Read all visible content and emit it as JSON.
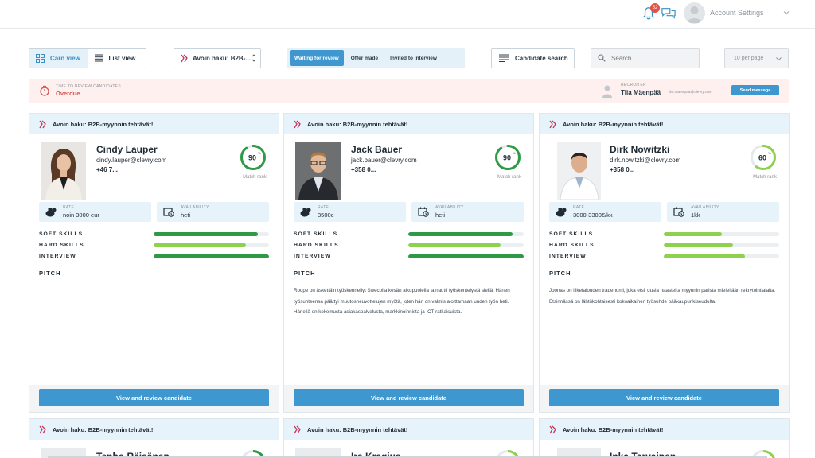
{
  "header": {
    "notification_count": "52",
    "account_label": "Account Settings"
  },
  "toolbar": {
    "card_view": "Card view",
    "list_view": "List view",
    "job_select": "Avoin haku: B2B-...",
    "status_tabs": [
      "Waiting for review",
      "Offer made",
      "Invited to interview"
    ],
    "candidate_search": "Candidate search",
    "search_placeholder": "Search",
    "per_page": "10 per page"
  },
  "banner": {
    "label": "TIME TO REVIEW CANDIDATES",
    "value": "Overdue",
    "recruiter_label": "RECRUITER",
    "recruiter_name": "Tiia Mäenpää",
    "recruiter_email": "tiia.maenpaa@clevry.com",
    "send_message": "Send message"
  },
  "colors": {
    "accent": "#3f97d0",
    "overdue": "#d9534f",
    "bar_dark": "#2e9a45",
    "bar_light": "#8dd14f"
  },
  "cards": [
    {
      "job": "Avoin haku: B2B-myynnin tehtävät!",
      "name": "Cindy Lauper",
      "email": "cindy.lauper@clevry.com",
      "phone": "+46 7...",
      "rank": "90",
      "rank_label": "Match rank",
      "rate_label": "RATE",
      "rate": "noin 3000 eur",
      "availability_label": "AVAILABILITY",
      "availability": "heti",
      "skills": [
        {
          "label": "SOFT SKILLS",
          "value": 0.9
        },
        {
          "label": "HARD SKILLS",
          "value": 0.8
        },
        {
          "label": "INTERVIEW",
          "value": 1.0
        }
      ],
      "pitch_label": "PITCH",
      "pitch": "",
      "button": "View and review candidate"
    },
    {
      "job": "Avoin haku: B2B-myynnin tehtävät!",
      "name": "Jack Bauer",
      "email": "jack.bauer@clevry.com",
      "phone": "+358 0...",
      "rank": "90",
      "rank_label": "Match rank",
      "rate_label": "RATE",
      "rate": "3500e",
      "availability_label": "AVAILABILITY",
      "availability": "heti",
      "skills": [
        {
          "label": "SOFT SKILLS",
          "value": 0.9
        },
        {
          "label": "HARD SKILLS",
          "value": 0.8
        },
        {
          "label": "INTERVIEW",
          "value": 1.0
        }
      ],
      "pitch_label": "PITCH",
      "pitch": "Roope on äskettäin työskennellyt Swecolla kesän alkupuolella ja nautti työskentelystä siellä. Hänen työsuhteensa päättyi muutosneuvottelujen myötä, joten hän on valmis aloittamaan uuden työn heti. Hänellä on kokemusta asiakaspalvelusta, markkinoinnista ja ICT-ratkaisuista.",
      "button": "View and review candidate"
    },
    {
      "job": "Avoin haku: B2B-myynnin tehtävät!",
      "name": "Dirk Nowitzki",
      "email": "dirk.nowitzki@clevry.com",
      "phone": "+358 0...",
      "rank": "60",
      "rank_label": "Match rank",
      "rate_label": "RATE",
      "rate": "3000-3300€/kk",
      "availability_label": "AVAILABILITY",
      "availability": "1kk",
      "skills": [
        {
          "label": "SOFT SKILLS",
          "value": 0.5
        },
        {
          "label": "HARD SKILLS",
          "value": 0.6
        },
        {
          "label": "INTERVIEW",
          "value": 0.7
        }
      ],
      "pitch_label": "PITCH",
      "pitch": "Joonas on liiketalouden tradenomi, joka etsii uusia haasteita myynnin parista mielellään rekrytointialalta. Etsinnässä on lähtökohtaisesti kokoaikainen työsuhde pääkaupunkiseudulta.",
      "button": "View and review candidate"
    }
  ],
  "next_cards": [
    {
      "job": "Avoin haku: B2B-myynnin tehtävät!",
      "name": "Tenho Räisänen"
    },
    {
      "job": "Avoin haku: B2B-myynnin tehtävät!",
      "name": "Ira Kragius"
    },
    {
      "job": "Avoin haku: B2B-myynnin tehtävät!",
      "name": "Inka Tarvainen"
    }
  ]
}
